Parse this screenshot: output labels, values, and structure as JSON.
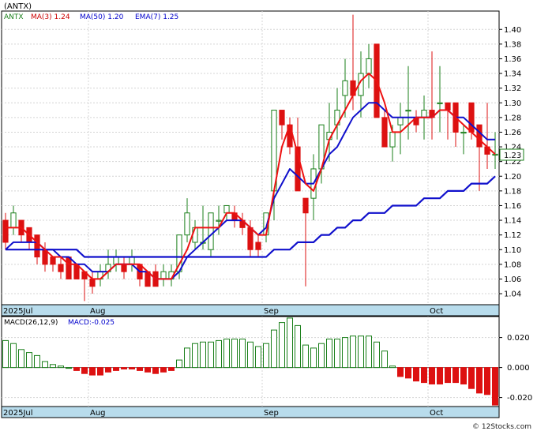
{
  "ticker_label": "(ANTX)",
  "price_legend": {
    "items": [
      {
        "text": "ANTX",
        "color": "#1a7f1a"
      },
      {
        "text": "MA(3)  1.24",
        "color": "#cc0000"
      },
      {
        "text": "MA(50)  1.20",
        "color": "#0000cc"
      },
      {
        "text": "EMA(7)  1.25",
        "color": "#0000cc"
      }
    ]
  },
  "macd_legend": {
    "items": [
      {
        "text": "MACD(26,12,9)",
        "color": "#000000"
      },
      {
        "text": "MACD:-0.025",
        "color": "#0000cc"
      }
    ]
  },
  "current_price_label": "1.23",
  "credit": "© 12Stocks.com",
  "colors": {
    "up": "#1a7f1a",
    "down": "#dd1111",
    "ma_red": "#ee1111",
    "ma_blue": "#1010cc",
    "axis_band": "#b8dcec",
    "grid": "#d4d4d4"
  },
  "chart_data": [
    {
      "type": "candlestick",
      "title": "(ANTX)",
      "y_ticks": [
        1.04,
        1.06,
        1.08,
        1.1,
        1.12,
        1.14,
        1.16,
        1.18,
        1.2,
        1.22,
        1.24,
        1.26,
        1.28,
        1.3,
        1.32,
        1.34,
        1.36,
        1.38,
        1.4
      ],
      "ylim": [
        1.025,
        1.425
      ],
      "x_labels": [
        {
          "index": 0,
          "label": "2025Jul"
        },
        {
          "index": 11,
          "label": "Aug"
        },
        {
          "index": 33,
          "label": "Sep"
        },
        {
          "index": 54,
          "label": "Oct"
        }
      ],
      "candles": [
        [
          1.14,
          1.15,
          1.1,
          1.11
        ],
        [
          1.13,
          1.16,
          1.12,
          1.15
        ],
        [
          1.14,
          1.14,
          1.11,
          1.12
        ],
        [
          1.13,
          1.13,
          1.1,
          1.11
        ],
        [
          1.12,
          1.12,
          1.08,
          1.09
        ],
        [
          1.1,
          1.11,
          1.07,
          1.08
        ],
        [
          1.09,
          1.09,
          1.07,
          1.08
        ],
        [
          1.08,
          1.09,
          1.06,
          1.07
        ],
        [
          1.09,
          1.09,
          1.06,
          1.06
        ],
        [
          1.08,
          1.08,
          1.06,
          1.06
        ],
        [
          1.07,
          1.07,
          1.03,
          1.06
        ],
        [
          1.06,
          1.07,
          1.04,
          1.05
        ],
        [
          1.06,
          1.08,
          1.05,
          1.07
        ],
        [
          1.07,
          1.1,
          1.06,
          1.08
        ],
        [
          1.08,
          1.1,
          1.07,
          1.09
        ],
        [
          1.08,
          1.09,
          1.06,
          1.07
        ],
        [
          1.08,
          1.1,
          1.07,
          1.09
        ],
        [
          1.08,
          1.08,
          1.05,
          1.06
        ],
        [
          1.07,
          1.07,
          1.05,
          1.05
        ],
        [
          1.07,
          1.08,
          1.05,
          1.05
        ],
        [
          1.06,
          1.08,
          1.05,
          1.07
        ],
        [
          1.06,
          1.08,
          1.05,
          1.07
        ],
        [
          1.07,
          1.12,
          1.06,
          1.12
        ],
        [
          1.12,
          1.17,
          1.11,
          1.15
        ],
        [
          1.11,
          1.14,
          1.1,
          1.13
        ],
        [
          1.11,
          1.16,
          1.1,
          1.11
        ],
        [
          1.1,
          1.15,
          1.09,
          1.15
        ],
        [
          1.14,
          1.16,
          1.12,
          1.14
        ],
        [
          1.15,
          1.16,
          1.14,
          1.16
        ],
        [
          1.15,
          1.16,
          1.13,
          1.14
        ],
        [
          1.14,
          1.15,
          1.12,
          1.13
        ],
        [
          1.13,
          1.14,
          1.09,
          1.1
        ],
        [
          1.11,
          1.12,
          1.09,
          1.1
        ],
        [
          1.12,
          1.15,
          1.11,
          1.15
        ],
        [
          1.18,
          1.29,
          1.14,
          1.29
        ],
        [
          1.29,
          1.29,
          1.25,
          1.27
        ],
        [
          1.27,
          1.28,
          1.23,
          1.24
        ],
        [
          1.24,
          1.28,
          1.18,
          1.18
        ],
        [
          1.17,
          1.17,
          1.05,
          1.15
        ],
        [
          1.17,
          1.23,
          1.14,
          1.21
        ],
        [
          1.21,
          1.27,
          1.19,
          1.27
        ],
        [
          1.25,
          1.3,
          1.22,
          1.26
        ],
        [
          1.27,
          1.32,
          1.25,
          1.29
        ],
        [
          1.31,
          1.36,
          1.28,
          1.33
        ],
        [
          1.33,
          1.42,
          1.29,
          1.31
        ],
        [
          1.31,
          1.37,
          1.28,
          1.34
        ],
        [
          1.34,
          1.38,
          1.32,
          1.36
        ],
        [
          1.38,
          1.38,
          1.28,
          1.28
        ],
        [
          1.28,
          1.29,
          1.24,
          1.24
        ],
        [
          1.24,
          1.27,
          1.22,
          1.26
        ],
        [
          1.27,
          1.3,
          1.23,
          1.28
        ],
        [
          1.29,
          1.35,
          1.25,
          1.29
        ],
        [
          1.28,
          1.29,
          1.26,
          1.27
        ],
        [
          1.28,
          1.31,
          1.25,
          1.29
        ],
        [
          1.29,
          1.37,
          1.25,
          1.28
        ],
        [
          1.3,
          1.35,
          1.26,
          1.3
        ],
        [
          1.3,
          1.3,
          1.25,
          1.29
        ],
        [
          1.3,
          1.3,
          1.24,
          1.26
        ],
        [
          1.26,
          1.27,
          1.23,
          1.26
        ],
        [
          1.3,
          1.3,
          1.25,
          1.26
        ],
        [
          1.27,
          1.27,
          1.18,
          1.24
        ],
        [
          1.24,
          1.3,
          1.21,
          1.23
        ],
        [
          1.23,
          1.26,
          1.21,
          1.23
        ]
      ],
      "ma3": [
        1.13,
        1.13,
        1.13,
        1.12,
        1.11,
        1.1,
        1.09,
        1.09,
        1.08,
        1.08,
        1.07,
        1.06,
        1.06,
        1.07,
        1.08,
        1.08,
        1.08,
        1.08,
        1.07,
        1.06,
        1.06,
        1.06,
        1.08,
        1.1,
        1.13,
        1.13,
        1.13,
        1.13,
        1.15,
        1.15,
        1.14,
        1.13,
        1.12,
        1.12,
        1.18,
        1.24,
        1.27,
        1.23,
        1.19,
        1.18,
        1.21,
        1.25,
        1.27,
        1.29,
        1.31,
        1.33,
        1.34,
        1.33,
        1.3,
        1.26,
        1.26,
        1.27,
        1.28,
        1.28,
        1.28,
        1.29,
        1.29,
        1.28,
        1.27,
        1.26,
        1.25,
        1.24,
        1.23
      ],
      "ma50": [
        1.1,
        1.1,
        1.1,
        1.1,
        1.1,
        1.1,
        1.1,
        1.1,
        1.1,
        1.1,
        1.09,
        1.09,
        1.09,
        1.09,
        1.09,
        1.09,
        1.09,
        1.09,
        1.09,
        1.09,
        1.09,
        1.09,
        1.09,
        1.09,
        1.09,
        1.09,
        1.09,
        1.09,
        1.09,
        1.09,
        1.09,
        1.09,
        1.09,
        1.09,
        1.1,
        1.1,
        1.1,
        1.11,
        1.11,
        1.11,
        1.12,
        1.12,
        1.13,
        1.13,
        1.14,
        1.14,
        1.15,
        1.15,
        1.15,
        1.16,
        1.16,
        1.16,
        1.16,
        1.17,
        1.17,
        1.17,
        1.18,
        1.18,
        1.18,
        1.19,
        1.19,
        1.19,
        1.2
      ],
      "ema7": [
        1.1,
        1.11,
        1.11,
        1.11,
        1.11,
        1.1,
        1.1,
        1.09,
        1.09,
        1.08,
        1.08,
        1.07,
        1.07,
        1.07,
        1.08,
        1.08,
        1.08,
        1.07,
        1.07,
        1.06,
        1.06,
        1.06,
        1.07,
        1.09,
        1.1,
        1.11,
        1.12,
        1.13,
        1.14,
        1.14,
        1.14,
        1.13,
        1.12,
        1.13,
        1.17,
        1.19,
        1.21,
        1.2,
        1.19,
        1.19,
        1.21,
        1.23,
        1.24,
        1.26,
        1.28,
        1.29,
        1.3,
        1.3,
        1.29,
        1.28,
        1.28,
        1.28,
        1.28,
        1.28,
        1.28,
        1.29,
        1.29,
        1.28,
        1.28,
        1.27,
        1.26,
        1.25,
        1.25
      ]
    },
    {
      "type": "bar",
      "title": "MACD(26,12,9)",
      "y_ticks": [
        0.02,
        0.0,
        -0.02
      ],
      "ylim": [
        -0.026,
        0.034
      ],
      "values": [
        0.018,
        0.016,
        0.012,
        0.01,
        0.008,
        0.004,
        0.002,
        0.001,
        0.0,
        -0.002,
        -0.004,
        -0.005,
        -0.005,
        -0.003,
        -0.002,
        -0.001,
        -0.001,
        -0.002,
        -0.003,
        -0.004,
        -0.003,
        -0.002,
        0.005,
        0.013,
        0.016,
        0.017,
        0.017,
        0.018,
        0.019,
        0.019,
        0.019,
        0.017,
        0.014,
        0.016,
        0.025,
        0.03,
        0.033,
        0.028,
        0.015,
        0.013,
        0.016,
        0.019,
        0.019,
        0.02,
        0.021,
        0.021,
        0.021,
        0.017,
        0.011,
        0.001,
        -0.006,
        -0.007,
        -0.009,
        -0.01,
        -0.011,
        -0.011,
        -0.01,
        -0.01,
        -0.011,
        -0.014,
        -0.017,
        -0.018,
        -0.025
      ]
    }
  ]
}
